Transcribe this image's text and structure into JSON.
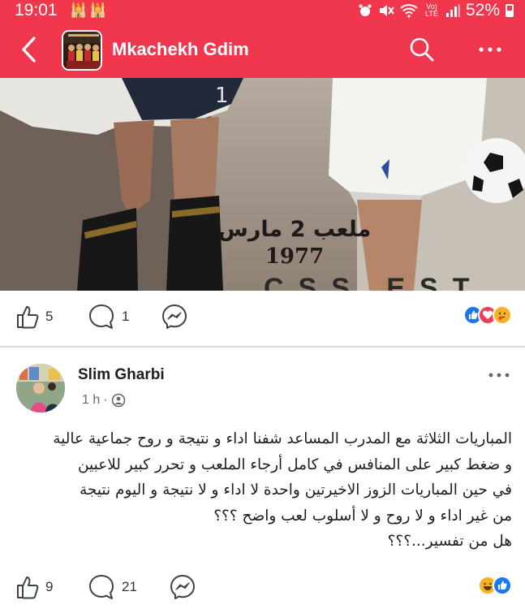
{
  "status_bar": {
    "time": "19:01",
    "left_icons": "🕌🕌",
    "lte_label": "Vo) LTE",
    "battery": "52%"
  },
  "header": {
    "title": "Mkachekh Gdim",
    "back_icon": "chevron-left-icon",
    "search_icon": "search-icon",
    "more_icon": "more-dots-icon"
  },
  "post": {
    "photo_caption_line1": "ملعب 2 مارس",
    "photo_caption_line2": "1977",
    "photo_bottom_text": "CSS EST",
    "like_count": "5",
    "comment_count": "1",
    "reactions": [
      "like",
      "love",
      "care"
    ]
  },
  "comment": {
    "author": "Slim Gharbi",
    "time": "1 h",
    "separator": " · ",
    "text_lines": [
      "المباريات الثلاثة مع المدرب المساعد شفنا اداء و نتيجة و روح جماعية عالية",
      "و ضغط كبير على المنافس في كامل أرجاء الملعب و تحرر كبير للاعبين",
      "في حين المباريات الزوز الاخيرتين واحدة لا اداء و لا نتيجة و اليوم نتيجة",
      "من غير اداء و لا روح و لا أسلوب لعب واضح ؟؟؟",
      "هل من تفسير...؟؟؟"
    ],
    "like_count": "9",
    "reply_count": "21",
    "reactions": [
      "haha",
      "like"
    ]
  },
  "colors": {
    "header_bg": "#f0374e",
    "like_blue": "#1877f2",
    "love_red": "#f33e58",
    "reaction_yellow": "#f7b125"
  }
}
